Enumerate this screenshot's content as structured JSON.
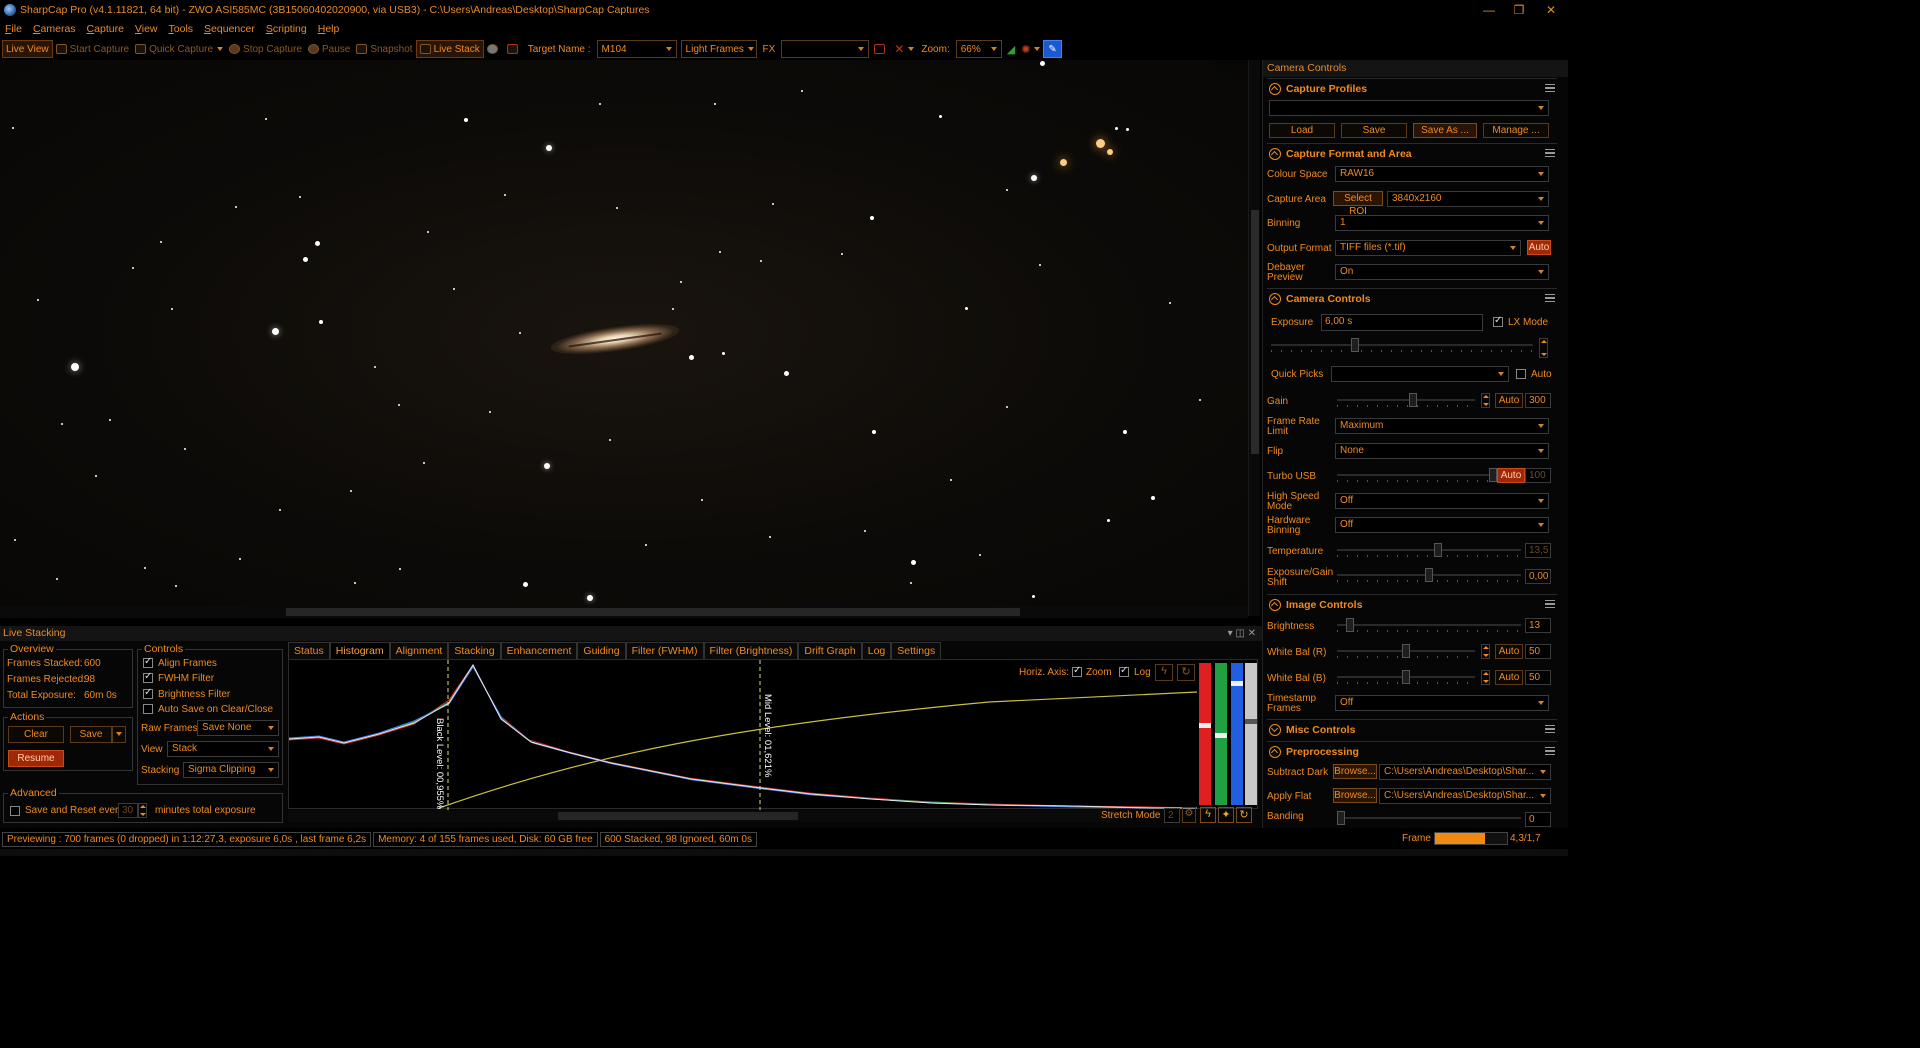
{
  "window": {
    "title": "SharpCap Pro (v4.1.11821, 64 bit) - ZWO ASI585MC (3B15060402020900, via USB3) - C:\\Users\\Andreas\\Desktop\\SharpCap Captures",
    "minimize": "—",
    "restore": "❐",
    "close": "✕"
  },
  "menu": [
    "File",
    "Cameras",
    "Capture",
    "View",
    "Tools",
    "Sequencer",
    "Scripting",
    "Help"
  ],
  "toolbar": {
    "live_view": "Live View",
    "start_capture": "Start Capture",
    "quick_capture": "Quick Capture",
    "stop_capture": "Stop Capture",
    "pause": "Pause",
    "snapshot": "Snapshot",
    "live_stack": "Live Stack",
    "target_label": "Target Name :",
    "target_value": "M104",
    "frame_type": "Light Frames",
    "fx_label": "FX",
    "fx_value": "",
    "zoom_label": "Zoom:",
    "zoom_value": "66%"
  },
  "right_panel": {
    "title": "Camera Controls",
    "capture_profiles": {
      "header": "Capture Profiles",
      "profile_value": "",
      "buttons": [
        "Load",
        "Save",
        "Save As ...",
        "Manage ..."
      ]
    },
    "capture_format": {
      "header": "Capture Format and Area",
      "colour_space_label": "Colour Space",
      "colour_space": "RAW16",
      "capture_area_label": "Capture Area",
      "select_roi": "Select ROI",
      "capture_area": "3840x2160",
      "binning_label": "Binning",
      "binning": "1",
      "output_format_label": "Output Format",
      "output_format": "TIFF files (*.tif)",
      "output_auto": "Auto",
      "debayer_label": "Debayer Preview",
      "debayer": "On"
    },
    "camera_controls": {
      "header": "Camera Controls",
      "exposure_label": "Exposure",
      "exposure_value": "6,00 s",
      "lx_mode_label": "LX Mode",
      "lx_mode": true,
      "quick_picks_label": "Quick Picks",
      "quick_picks_value": "",
      "quick_auto_label": "Auto",
      "gain_label": "Gain",
      "gain_auto": "Auto",
      "gain_value": "300",
      "gain_level": 0.55,
      "frame_rate_label": "Frame Rate Limit",
      "frame_rate": "Maximum",
      "flip_label": "Flip",
      "flip": "None",
      "turbo_label": "Turbo USB",
      "turbo_auto": "Auto",
      "turbo_value": "100",
      "turbo_level": 1.0,
      "high_speed_label": "High Speed Mode",
      "high_speed": "Off",
      "hw_binning_label": "Hardware Binning",
      "hw_binning": "Off",
      "temperature_label": "Temperature",
      "temperature_value": "13,5",
      "temperature_level": 0.55,
      "exp_gain_shift_label": "Exposure/Gain Shift",
      "exp_gain_shift_value": "0,00",
      "exp_gain_shift_level": 0.5
    },
    "image_controls": {
      "header": "Image Controls",
      "brightness_label": "Brightness",
      "brightness_value": "13",
      "brightness_level": 0.05,
      "wb_r_label": "White Bal (R)",
      "wb_r_auto": "Auto",
      "wb_r_value": "50",
      "wb_r_level": 0.5,
      "wb_b_label": "White Bal (B)",
      "wb_b_auto": "Auto",
      "wb_b_value": "50",
      "wb_b_level": 0.5,
      "timestamp_label": "Timestamp Frames",
      "timestamp": "Off"
    },
    "misc_controls": {
      "header": "Misc Controls"
    },
    "preprocessing": {
      "header": "Preprocessing",
      "dark_label": "Subtract Dark",
      "dark_browse": "Browse...",
      "dark_path": "C:\\Users\\Andreas\\Desktop\\Shar...",
      "flat_label": "Apply Flat",
      "flat_browse": "Browse...",
      "flat_path": "C:\\Users\\Andreas\\Desktop\\Shar...",
      "banding_label": "Banding",
      "banding_value": "0"
    }
  },
  "live_stacking": {
    "title": "Live Stacking",
    "overview": {
      "title": "Overview",
      "frames_stacked_label": "Frames Stacked:",
      "frames_stacked": "600",
      "frames_rejected_label": "Frames Rejected:",
      "frames_rejected": "98",
      "total_exposure_label": "Total Exposure:",
      "total_exposure": "60m 0s"
    },
    "actions": {
      "title": "Actions",
      "clear": "Clear",
      "save": "Save",
      "resume": "Resume"
    },
    "advanced": {
      "title": "Advanced",
      "save_reset_label": "Save and Reset every",
      "save_reset_value": "30",
      "save_reset_suffix": "minutes total exposure"
    },
    "controls": {
      "title": "Controls",
      "align_frames": "Align Frames",
      "fwhm_filter": "FWHM Filter",
      "brightness_filter": "Brightness Filter",
      "auto_save": "Auto Save on Clear/Close",
      "raw_frames_label": "Raw Frames",
      "raw_frames": "Save None",
      "view_label": "View",
      "view": "Stack",
      "stacking_label": "Stacking",
      "stacking": "Sigma Clipping"
    },
    "tabs": [
      "Status",
      "Histogram",
      "Alignment",
      "Stacking",
      "Enhancement",
      "Guiding",
      "Filter (FWHM)",
      "Filter (Brightness)",
      "Drift Graph",
      "Log",
      "Settings"
    ],
    "histogram": {
      "horiz_axis_label": "Horiz. Axis:",
      "zoom_label": "Zoom",
      "log_label": "Log",
      "black_level": "Black Level: 00,955%",
      "mid_level": "Mid Level: 01,621%",
      "stretch_mode_label": "Stretch Mode",
      "stretch_mode_value": "2"
    }
  },
  "status_bar": {
    "preview": "Previewing : 700 frames (0 dropped) in 1:12:27,3, exposure 6,0s , last frame 6,2s",
    "memory": "Memory: 4 of 155 frames used, Disk: 60 GB free",
    "stack": "600 Stacked, 98 Ignored, 60m 0s",
    "frame_label": "Frame :",
    "frame_value": "4,3/1,7",
    "frame_level": 0.7
  }
}
